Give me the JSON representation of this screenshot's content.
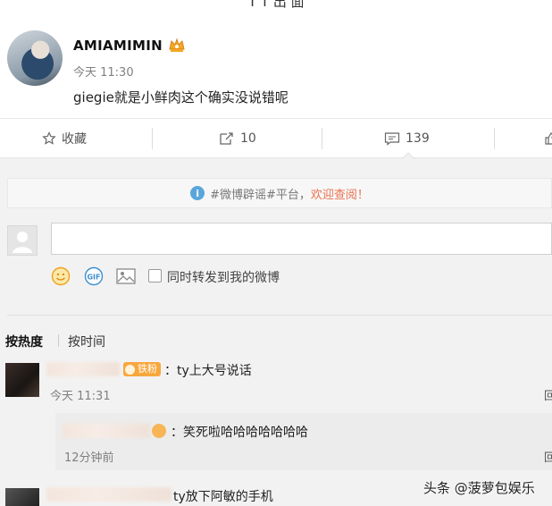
{
  "header": {
    "title_fragment": "T T 出 面"
  },
  "post": {
    "username": "AMIAMIMIN",
    "time": "今天 11:30",
    "text": "giegie就是小鲜肉这个确实没说错呢",
    "user_badge_icon": "vip-crown-icon"
  },
  "actions": {
    "favorite_label": "收藏",
    "repost_count": "10",
    "comment_count": "139"
  },
  "rumor_notice": {
    "prefix": "#微博辟谣#平台，",
    "link": "欢迎查阅！"
  },
  "composer": {
    "repost_checkbox_label": "同时转发到我的微博",
    "checked": false
  },
  "sort_tabs": [
    "按热度",
    "按时间"
  ],
  "comments": [
    {
      "badge": "铁粉",
      "text": "：ty上大号说话",
      "time": "今天 11:31",
      "reply_stub": "回",
      "replies": [
        {
          "text": "：笑死啦哈哈哈哈哈哈哈",
          "time": "12分钟前",
          "reply_stub": "回"
        }
      ]
    },
    {
      "text": "ty放下阿敏的手机"
    }
  ],
  "watermark": "头条 @菠萝包娱乐",
  "colors": {
    "accent": "#eb7350",
    "badge": "#f8a73d",
    "info": "#5aa6dc"
  }
}
